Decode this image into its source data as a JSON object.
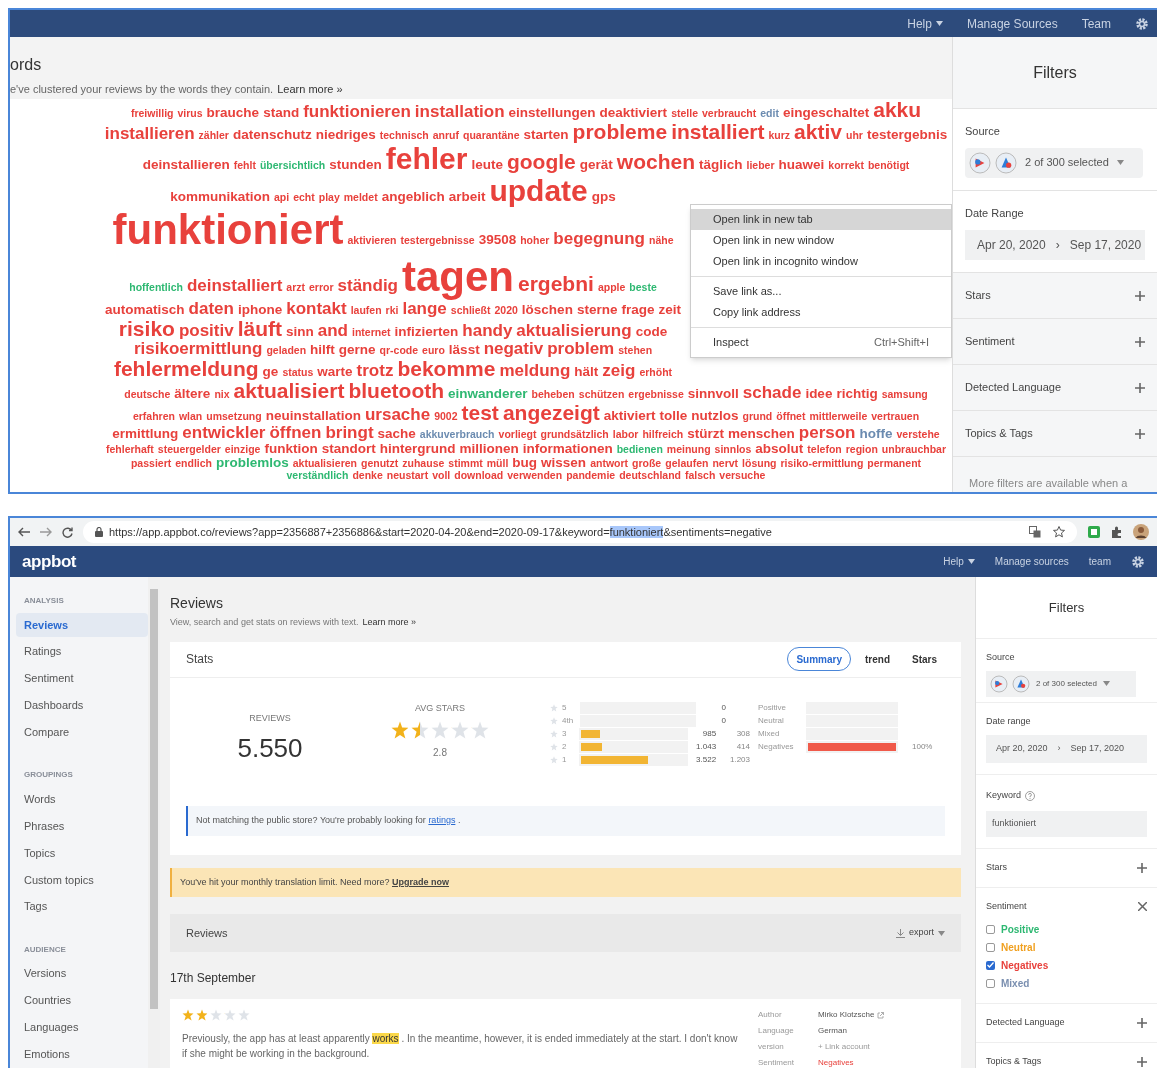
{
  "top_window": {
    "nav": [
      {
        "label": "Help",
        "dropdown": true
      },
      {
        "label": "Manage Sources",
        "dropdown": false
      },
      {
        "label": "Team",
        "dropdown": false
      }
    ],
    "page_title": "ords",
    "subtitle": "e've clustered your reviews by the words they contain.",
    "learn_more": "Learn more »",
    "word_cloud": [
      {
        "text": "freiwillig",
        "kind": "xs",
        "color": "#e8413c"
      },
      {
        "text": "virus",
        "kind": "xs",
        "color": "#e8413c"
      },
      {
        "text": "brauche",
        "kind": "s",
        "color": "#e8413c"
      },
      {
        "text": "stand",
        "kind": "s",
        "color": "#e8413c"
      },
      {
        "text": "funktionieren",
        "kind": "m",
        "color": "#e8413c"
      },
      {
        "text": "installation",
        "kind": "m",
        "color": "#e8413c"
      },
      {
        "text": "einstellungen",
        "kind": "s",
        "color": "#e8413c"
      },
      {
        "text": "deaktiviert",
        "kind": "s",
        "color": "#e8413c"
      },
      {
        "text": "stelle",
        "kind": "xs",
        "color": "#e8413c"
      },
      {
        "text": "verbraucht",
        "kind": "xs",
        "color": "#e8413c"
      },
      {
        "text": "edit",
        "kind": "xs",
        "color": "#6b8bb0"
      },
      {
        "text": "eingeschaltet",
        "kind": "s",
        "color": "#e8413c"
      },
      {
        "text": "akku",
        "kind": "l",
        "color": "#e8413c"
      },
      {
        "text": "installieren",
        "kind": "m",
        "color": "#e8413c"
      },
      {
        "text": "zähler",
        "kind": "xs",
        "color": "#e8413c"
      },
      {
        "text": "datenschutz",
        "kind": "s",
        "color": "#e8413c"
      },
      {
        "text": "niedriges",
        "kind": "s",
        "color": "#e8413c"
      },
      {
        "text": "technisch",
        "kind": "xs",
        "color": "#e8413c"
      },
      {
        "text": "anruf",
        "kind": "xs",
        "color": "#e8413c"
      },
      {
        "text": "quarantäne",
        "kind": "xs",
        "color": "#e8413c"
      },
      {
        "text": "starten",
        "kind": "s",
        "color": "#e8413c"
      },
      {
        "text": "probleme",
        "kind": "l",
        "color": "#e8413c"
      },
      {
        "text": "installiert",
        "kind": "l",
        "color": "#e8413c"
      },
      {
        "text": "kurz",
        "kind": "xs",
        "color": "#e8413c"
      },
      {
        "text": "aktiv",
        "kind": "l",
        "color": "#e8413c"
      },
      {
        "text": "uhr",
        "kind": "xs",
        "color": "#e8413c"
      },
      {
        "text": "testergebnis",
        "kind": "s",
        "color": "#e8413c"
      },
      {
        "text": "deinstallieren",
        "kind": "s",
        "color": "#e8413c"
      },
      {
        "text": "fehlt",
        "kind": "xs",
        "color": "#e8413c"
      },
      {
        "text": "übersichtlich",
        "kind": "xs",
        "color": "#2eb872"
      },
      {
        "text": "stunden",
        "kind": "s",
        "color": "#e8413c"
      },
      {
        "text": "fehler",
        "kind": "xl",
        "color": "#e8413c"
      },
      {
        "text": "leute",
        "kind": "s",
        "color": "#e8413c"
      },
      {
        "text": "google",
        "kind": "l",
        "color": "#e8413c"
      },
      {
        "text": "gerät",
        "kind": "s",
        "color": "#e8413c"
      },
      {
        "text": "wochen",
        "kind": "l",
        "color": "#e8413c"
      },
      {
        "text": "täglich",
        "kind": "s",
        "color": "#e8413c"
      },
      {
        "text": "lieber",
        "kind": "xs",
        "color": "#e8413c"
      },
      {
        "text": "huawei",
        "kind": "s",
        "color": "#e8413c"
      },
      {
        "text": "korrekt",
        "kind": "xs",
        "color": "#e8413c"
      },
      {
        "text": "benötigt",
        "kind": "xs",
        "color": "#e8413c"
      },
      {
        "text": "kommunikation",
        "kind": "s",
        "color": "#e8413c"
      },
      {
        "text": "api",
        "kind": "xs",
        "color": "#e8413c"
      },
      {
        "text": "echt",
        "kind": "xs",
        "color": "#e8413c"
      },
      {
        "text": "play",
        "kind": "xs",
        "color": "#e8413c"
      },
      {
        "text": "meldet",
        "kind": "xs",
        "color": "#e8413c"
      },
      {
        "text": "angeblich",
        "kind": "s",
        "color": "#e8413c"
      },
      {
        "text": "arbeit",
        "kind": "s",
        "color": "#e8413c"
      },
      {
        "text": "update",
        "kind": "xl",
        "color": "#e8413c"
      },
      {
        "text": "gps",
        "kind": "s",
        "color": "#e8413c"
      },
      {
        "text": "funktioniert",
        "kind": "xxl",
        "color": "#e8413c"
      },
      {
        "text": "aktivieren",
        "kind": "xs",
        "color": "#e8413c"
      },
      {
        "text": "testergebnisse",
        "kind": "xs",
        "color": "#e8413c"
      },
      {
        "text": "39508",
        "kind": "s",
        "color": "#e8413c"
      },
      {
        "text": "hoher",
        "kind": "xs",
        "color": "#e8413c"
      },
      {
        "text": "begegnung",
        "kind": "m",
        "color": "#e8413c"
      },
      {
        "text": "nähe",
        "kind": "xs",
        "color": "#e8413c"
      },
      {
        "text": "hoffentlich",
        "kind": "xs",
        "color": "#2eb872"
      },
      {
        "text": "deinstalliert",
        "kind": "m",
        "color": "#e8413c"
      },
      {
        "text": "arzt",
        "kind": "xs",
        "color": "#e8413c"
      },
      {
        "text": "error",
        "kind": "xs",
        "color": "#e8413c"
      },
      {
        "text": "ständig",
        "kind": "m",
        "color": "#e8413c"
      },
      {
        "text": "tagen",
        "kind": "xxl",
        "color": "#e8413c"
      },
      {
        "text": "ergebni",
        "kind": "l",
        "color": "#e8413c"
      },
      {
        "text": "apple",
        "kind": "xs",
        "color": "#e8413c"
      },
      {
        "text": "beste",
        "kind": "xs",
        "color": "#2eb872"
      },
      {
        "text": "automatisch",
        "kind": "s",
        "color": "#e8413c"
      },
      {
        "text": "daten",
        "kind": "m",
        "color": "#e8413c"
      },
      {
        "text": "iphone",
        "kind": "s",
        "color": "#e8413c"
      },
      {
        "text": "kontakt",
        "kind": "m",
        "color": "#e8413c"
      },
      {
        "text": "laufen",
        "kind": "xs",
        "color": "#e8413c"
      },
      {
        "text": "rki",
        "kind": "xs",
        "color": "#e8413c"
      },
      {
        "text": "lange",
        "kind": "m",
        "color": "#e8413c"
      },
      {
        "text": "schließt",
        "kind": "xs",
        "color": "#e8413c"
      },
      {
        "text": "2020",
        "kind": "xs",
        "color": "#e8413c"
      },
      {
        "text": "löschen",
        "kind": "s",
        "color": "#e8413c"
      },
      {
        "text": "sterne",
        "kind": "s",
        "color": "#e8413c"
      },
      {
        "text": "frage",
        "kind": "s",
        "color": "#e8413c"
      },
      {
        "text": "zeit",
        "kind": "s",
        "color": "#e8413c"
      },
      {
        "text": "risiko",
        "kind": "l",
        "color": "#e8413c"
      },
      {
        "text": "positiv",
        "kind": "m",
        "color": "#e8413c"
      },
      {
        "text": "läuft",
        "kind": "l",
        "color": "#e8413c"
      },
      {
        "text": "sinn",
        "kind": "s",
        "color": "#e8413c"
      },
      {
        "text": "and",
        "kind": "m",
        "color": "#e8413c"
      },
      {
        "text": "internet",
        "kind": "xs",
        "color": "#e8413c"
      },
      {
        "text": "infizierten",
        "kind": "s",
        "color": "#e8413c"
      },
      {
        "text": "handy",
        "kind": "m",
        "color": "#e8413c"
      },
      {
        "text": "aktualisierung",
        "kind": "m",
        "color": "#e8413c"
      },
      {
        "text": "code",
        "kind": "s",
        "color": "#e8413c"
      },
      {
        "text": "risikoermittlung",
        "kind": "m",
        "color": "#e8413c"
      },
      {
        "text": "geladen",
        "kind": "xs",
        "color": "#e8413c"
      },
      {
        "text": "hilft",
        "kind": "s",
        "color": "#e8413c"
      },
      {
        "text": "gerne",
        "kind": "s",
        "color": "#e8413c"
      },
      {
        "text": "qr-code",
        "kind": "xs",
        "color": "#e8413c"
      },
      {
        "text": "euro",
        "kind": "xs",
        "color": "#e8413c"
      },
      {
        "text": "lässt",
        "kind": "s",
        "color": "#e8413c"
      },
      {
        "text": "negativ",
        "kind": "m",
        "color": "#e8413c"
      },
      {
        "text": "problem",
        "kind": "m",
        "color": "#e8413c"
      },
      {
        "text": "stehen",
        "kind": "xs",
        "color": "#e8413c"
      },
      {
        "text": "fehlermeldung",
        "kind": "l",
        "color": "#e8413c"
      },
      {
        "text": "ge",
        "kind": "s",
        "color": "#e8413c"
      },
      {
        "text": "status",
        "kind": "xs",
        "color": "#e8413c"
      },
      {
        "text": "warte",
        "kind": "s",
        "color": "#e8413c"
      },
      {
        "text": "trotz",
        "kind": "m",
        "color": "#e8413c"
      },
      {
        "text": "bekomme",
        "kind": "l",
        "color": "#e8413c"
      },
      {
        "text": "meldung",
        "kind": "m",
        "color": "#e8413c"
      },
      {
        "text": "hält",
        "kind": "s",
        "color": "#e8413c"
      },
      {
        "text": "zeig",
        "kind": "m",
        "color": "#e8413c"
      },
      {
        "text": "erhöht",
        "kind": "xs",
        "color": "#e8413c"
      },
      {
        "text": "deutsche",
        "kind": "xs",
        "color": "#e8413c"
      },
      {
        "text": "ältere",
        "kind": "s",
        "color": "#e8413c"
      },
      {
        "text": "nix",
        "kind": "xs",
        "color": "#e8413c"
      },
      {
        "text": "aktualisiert",
        "kind": "l",
        "color": "#e8413c"
      },
      {
        "text": "bluetooth",
        "kind": "l",
        "color": "#e8413c"
      },
      {
        "text": "einwanderer",
        "kind": "s",
        "color": "#2eb872"
      },
      {
        "text": "beheben",
        "kind": "xs",
        "color": "#e8413c"
      },
      {
        "text": "schützen",
        "kind": "xs",
        "color": "#e8413c"
      },
      {
        "text": "ergebnisse",
        "kind": "xs",
        "color": "#e8413c"
      },
      {
        "text": "sinnvoll",
        "kind": "s",
        "color": "#e8413c"
      },
      {
        "text": "schade",
        "kind": "m",
        "color": "#e8413c"
      },
      {
        "text": "idee",
        "kind": "s",
        "color": "#e8413c"
      },
      {
        "text": "richtig",
        "kind": "s",
        "color": "#e8413c"
      },
      {
        "text": "samsung",
        "kind": "xs",
        "color": "#e8413c"
      },
      {
        "text": "erfahren",
        "kind": "xs",
        "color": "#e8413c"
      },
      {
        "text": "wlan",
        "kind": "xs",
        "color": "#e8413c"
      },
      {
        "text": "umsetzung",
        "kind": "xs",
        "color": "#e8413c"
      },
      {
        "text": "neuinstallation",
        "kind": "s",
        "color": "#e8413c"
      },
      {
        "text": "ursache",
        "kind": "m",
        "color": "#e8413c"
      },
      {
        "text": "9002",
        "kind": "xs",
        "color": "#e8413c"
      },
      {
        "text": "test",
        "kind": "l",
        "color": "#e8413c"
      },
      {
        "text": "angezeigt",
        "kind": "l",
        "color": "#e8413c"
      },
      {
        "text": "aktiviert",
        "kind": "s",
        "color": "#e8413c"
      },
      {
        "text": "tolle",
        "kind": "s",
        "color": "#e8413c"
      },
      {
        "text": "nutzlos",
        "kind": "s",
        "color": "#e8413c"
      },
      {
        "text": "grund",
        "kind": "xs",
        "color": "#e8413c"
      },
      {
        "text": "öffnet",
        "kind": "xs",
        "color": "#e8413c"
      },
      {
        "text": "mittlerweile",
        "kind": "xs",
        "color": "#e8413c"
      },
      {
        "text": "vertrauen",
        "kind": "xs",
        "color": "#e8413c"
      },
      {
        "text": "ermittlung",
        "kind": "s",
        "color": "#e8413c"
      },
      {
        "text": "entwickler",
        "kind": "m",
        "color": "#e8413c"
      },
      {
        "text": "öffnen",
        "kind": "m",
        "color": "#e8413c"
      },
      {
        "text": "bringt",
        "kind": "m",
        "color": "#e8413c"
      },
      {
        "text": "sache",
        "kind": "s",
        "color": "#e8413c"
      },
      {
        "text": "akkuverbrauch",
        "kind": "xs",
        "color": "#6b8bb0"
      },
      {
        "text": "vorliegt",
        "kind": "xs",
        "color": "#e8413c"
      },
      {
        "text": "grundsätzlich",
        "kind": "xs",
        "color": "#e8413c"
      },
      {
        "text": "labor",
        "kind": "xs",
        "color": "#e8413c"
      },
      {
        "text": "hilfreich",
        "kind": "xs",
        "color": "#e8413c"
      },
      {
        "text": "stürzt",
        "kind": "s",
        "color": "#e8413c"
      },
      {
        "text": "menschen",
        "kind": "s",
        "color": "#e8413c"
      },
      {
        "text": "person",
        "kind": "m",
        "color": "#e8413c"
      },
      {
        "text": "hoffe",
        "kind": "s",
        "color": "#6b8bb0"
      },
      {
        "text": "verstehe",
        "kind": "xs",
        "color": "#e8413c"
      },
      {
        "text": "fehlerhaft",
        "kind": "xs",
        "color": "#e8413c"
      },
      {
        "text": "steuergelder",
        "kind": "xs",
        "color": "#e8413c"
      },
      {
        "text": "einzige",
        "kind": "xs",
        "color": "#e8413c"
      },
      {
        "text": "funktion",
        "kind": "s",
        "color": "#e8413c"
      },
      {
        "text": "standort",
        "kind": "s",
        "color": "#e8413c"
      },
      {
        "text": "hintergrund",
        "kind": "s",
        "color": "#e8413c"
      },
      {
        "text": "millionen",
        "kind": "s",
        "color": "#e8413c"
      },
      {
        "text": "informationen",
        "kind": "s",
        "color": "#e8413c"
      },
      {
        "text": "bedienen",
        "kind": "xs",
        "color": "#2eb872"
      },
      {
        "text": "meinung",
        "kind": "xs",
        "color": "#e8413c"
      },
      {
        "text": "sinnlos",
        "kind": "xs",
        "color": "#e8413c"
      },
      {
        "text": "absolut",
        "kind": "s",
        "color": "#e8413c"
      },
      {
        "text": "telefon",
        "kind": "xs",
        "color": "#e8413c"
      },
      {
        "text": "region",
        "kind": "xs",
        "color": "#e8413c"
      },
      {
        "text": "unbrauchbar",
        "kind": "xs",
        "color": "#e8413c"
      },
      {
        "text": "passiert",
        "kind": "xs",
        "color": "#e8413c"
      },
      {
        "text": "endlich",
        "kind": "xs",
        "color": "#e8413c"
      },
      {
        "text": "problemlos",
        "kind": "s",
        "color": "#2eb872"
      },
      {
        "text": "aktualisieren",
        "kind": "xs",
        "color": "#e8413c"
      },
      {
        "text": "genutzt",
        "kind": "xs",
        "color": "#e8413c"
      },
      {
        "text": "zuhause",
        "kind": "xs",
        "color": "#e8413c"
      },
      {
        "text": "stimmt",
        "kind": "xs",
        "color": "#e8413c"
      },
      {
        "text": "müll",
        "kind": "xs",
        "color": "#e8413c"
      },
      {
        "text": "bug",
        "kind": "s",
        "color": "#e8413c"
      },
      {
        "text": "wissen",
        "kind": "s",
        "color": "#e8413c"
      },
      {
        "text": "antwort",
        "kind": "xs",
        "color": "#e8413c"
      },
      {
        "text": "große",
        "kind": "xs",
        "color": "#e8413c"
      },
      {
        "text": "gelaufen",
        "kind": "xs",
        "color": "#e8413c"
      },
      {
        "text": "nervt",
        "kind": "xs",
        "color": "#e8413c"
      },
      {
        "text": "lösung",
        "kind": "xs",
        "color": "#e8413c"
      },
      {
        "text": "risiko-ermittlung",
        "kind": "xs",
        "color": "#e8413c"
      },
      {
        "text": "permanent",
        "kind": "xs",
        "color": "#e8413c"
      },
      {
        "text": "verständlich",
        "kind": "xs",
        "color": "#2eb872"
      },
      {
        "text": "denke",
        "kind": "xs",
        "color": "#e8413c"
      },
      {
        "text": "neustart",
        "kind": "xs",
        "color": "#e8413c"
      },
      {
        "text": "voll",
        "kind": "xs",
        "color": "#e8413c"
      },
      {
        "text": "download",
        "kind": "xs",
        "color": "#e8413c"
      },
      {
        "text": "verwenden",
        "kind": "xs",
        "color": "#e8413c"
      },
      {
        "text": "pandemie",
        "kind": "xs",
        "color": "#e8413c"
      },
      {
        "text": "deutschland",
        "kind": "xs",
        "color": "#e8413c"
      },
      {
        "text": "falsch",
        "kind": "xs",
        "color": "#e8413c"
      },
      {
        "text": "versuche",
        "kind": "xs",
        "color": "#e8413c"
      }
    ],
    "context_menu": [
      [
        {
          "label": "Open link in new tab",
          "selected": true
        },
        {
          "label": "Open link in new window",
          "selected": false
        },
        {
          "label": "Open link in incognito window",
          "selected": false
        }
      ],
      [
        {
          "label": "Save link as...",
          "selected": false
        },
        {
          "label": "Copy link address",
          "selected": false
        }
      ],
      [
        {
          "label": "Inspect",
          "shortcut": "Ctrl+Shift+I",
          "selected": false
        }
      ]
    ],
    "filters": {
      "title": "Filters",
      "source_label": "Source",
      "source_value": "2 of 300 selected",
      "date_label": "Date Range",
      "date_from": "Apr 20, 2020",
      "date_arrow": "›",
      "date_to": "Sep 17, 2020",
      "sections": [
        "Stars",
        "Sentiment",
        "Detected Language",
        "Topics & Tags"
      ],
      "footer": "More filters are available when a"
    }
  },
  "browser": {
    "url_before": "https://app.appbot.co/reviews?app=2356887+2356886&start=2020-04-20&end=2020-09-17&keyword=",
    "url_selected": "funktioniert",
    "url_after": "&sentiments=negative"
  },
  "app": {
    "logo": "appbot",
    "nav": [
      {
        "label": "Help",
        "dropdown": true
      },
      {
        "label": "Manage sources",
        "dropdown": false
      },
      {
        "label": "team",
        "dropdown": false
      }
    ],
    "sidebar": [
      {
        "heading": "ANALYSIS",
        "items": [
          {
            "label": "Reviews",
            "selected": true
          },
          {
            "label": "Ratings",
            "selected": false
          },
          {
            "label": "Sentiment",
            "selected": false
          },
          {
            "label": "Dashboards",
            "selected": false
          },
          {
            "label": "Compare",
            "selected": false
          }
        ]
      },
      {
        "heading": "GROUPINGS",
        "items": [
          {
            "label": "Words",
            "selected": false
          },
          {
            "label": "Phrases",
            "selected": false
          },
          {
            "label": "Topics",
            "selected": false
          },
          {
            "label": "Custom topics",
            "selected": false
          },
          {
            "label": "Tags",
            "selected": false
          }
        ]
      },
      {
        "heading": "AUDIENCE",
        "items": [
          {
            "label": "Versions",
            "selected": false
          },
          {
            "label": "Countries",
            "selected": false
          },
          {
            "label": "Languages",
            "selected": false
          },
          {
            "label": "Emotions",
            "selected": false
          }
        ]
      }
    ],
    "page_title": "Reviews",
    "subtitle": "View, search and get stats on reviews with text.",
    "learn_more": "Learn more »",
    "stats": {
      "title": "Stats",
      "tabs": [
        {
          "label": "Summary",
          "selected": true
        },
        {
          "label": "trend",
          "selected": false
        },
        {
          "label": "Stars",
          "selected": false
        }
      ],
      "reviews_label": "REVIEWS",
      "reviews_value": "5.550",
      "avg_label": "AVG STARS",
      "stars": 1.5,
      "avg_value": "2.8",
      "distribution": [
        {
          "label": "5",
          "count": "0",
          "level": 0
        },
        {
          "label": "4th",
          "count": "0",
          "level": 0
        },
        {
          "label": "3",
          "count": "985",
          "extra": "308",
          "level": 0.18
        },
        {
          "label": "2",
          "count": "1.043",
          "extra": "414",
          "level": 0.2
        },
        {
          "label": "1",
          "count": "3.522",
          "extra": "1.203",
          "level": 0.64
        }
      ],
      "sentiment": [
        {
          "label": "Positive",
          "level": 0
        },
        {
          "label": "Neutral",
          "level": 0
        },
        {
          "label": "Mixed",
          "level": 0
        },
        {
          "label": "Negatives",
          "level": 1,
          "reading": "100%"
        }
      ],
      "notice": "Not matching the public store? You're probably looking for",
      "notice_link": "ratings",
      "notice_end": "."
    },
    "warning": "You've hit your monthly translation limit. Need more?",
    "warning_link": "Upgrade now",
    "reviews_bar": {
      "title": "Reviews",
      "export": "export"
    },
    "date_heading": "17th September",
    "review": {
      "stars": 2,
      "text_before": "Previously, the app has at least apparently",
      "highlight": "works",
      "text_after": ". In the meantime, however, it is ended immediately at the start. I don't know if she might be working in the background.",
      "meta": [
        {
          "label": "Author",
          "value": "Mirko Klotzsche",
          "kind": "author"
        },
        {
          "label": "Language",
          "value": "German",
          "kind": "text"
        },
        {
          "label": "version",
          "value": "+ Link account",
          "kind": "link"
        },
        {
          "label": "Sentiment",
          "value": "Negatives",
          "kind": "negative"
        }
      ]
    },
    "filters": {
      "title": "Filters",
      "source_label": "Source",
      "source_value": "2 of 300 selected",
      "date_label": "Date range",
      "date_from": "Apr 20, 2020",
      "date_arrow": "›",
      "date_to": "Sep 17, 2020",
      "keyword_label": "Keyword",
      "keyword_value": "funktioniert",
      "sections": [
        {
          "label": "Stars",
          "expanded": false
        },
        {
          "label": "Sentiment",
          "expanded": true,
          "options": [
            {
              "label": "Positive",
              "checked": false,
              "color": "#2eb872"
            },
            {
              "label": "Neutral",
              "checked": false,
              "color": "#f0a020"
            },
            {
              "label": "Negatives",
              "checked": true,
              "color": "#e8413c"
            },
            {
              "label": "Mixed",
              "checked": false,
              "color": "#7a8fb0"
            }
          ]
        },
        {
          "label": "Detected Language",
          "expanded": false
        },
        {
          "label": "Topics & Tags",
          "expanded": false
        }
      ]
    }
  }
}
